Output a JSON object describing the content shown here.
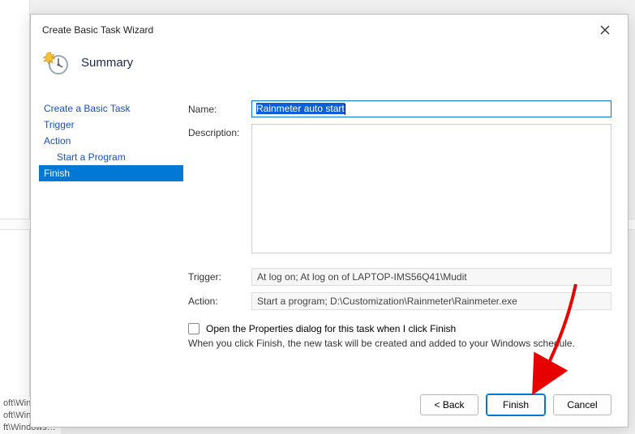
{
  "background": {
    "snips": [
      "oft\\Winc",
      "oft\\Windows\\O...",
      "ft\\Windows\\El..."
    ]
  },
  "dialog": {
    "title": "Create Basic Task Wizard",
    "wizard_heading": "Summary",
    "close_label": "Close",
    "steps": [
      {
        "label": "Create a Basic Task",
        "sub": false,
        "active": false
      },
      {
        "label": "Trigger",
        "sub": false,
        "active": false
      },
      {
        "label": "Action",
        "sub": false,
        "active": false
      },
      {
        "label": "Start a Program",
        "sub": true,
        "active": false
      },
      {
        "label": "Finish",
        "sub": false,
        "active": true
      }
    ],
    "form": {
      "name_label": "Name:",
      "name_value": "Rainmeter auto start",
      "description_label": "Description:",
      "description_value": "",
      "trigger_label": "Trigger:",
      "trigger_value": "At log on; At log on of LAPTOP-IMS56Q41\\Mudit",
      "action_label": "Action:",
      "action_value": "Start a program; D:\\Customization\\Rainmeter\\Rainmeter.exe"
    },
    "checkbox_label": "Open the Properties dialog for this task when I click Finish",
    "checkbox_checked": false,
    "note": "When you click Finish, the new task will be created and added to your Windows schedule.",
    "buttons": {
      "back": "< Back",
      "finish": "Finish",
      "cancel": "Cancel"
    }
  }
}
